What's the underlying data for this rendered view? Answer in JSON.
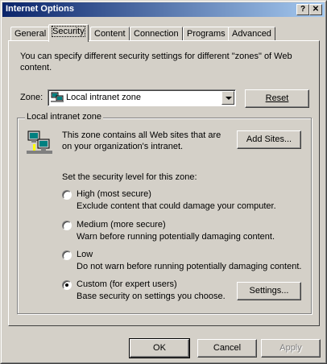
{
  "window": {
    "title": "Internet Options",
    "help_glyph": "?",
    "close_glyph": "✕"
  },
  "tabs": [
    {
      "label": "General"
    },
    {
      "label": "Security",
      "active": true
    },
    {
      "label": "Content"
    },
    {
      "label": "Connection"
    },
    {
      "label": "Programs"
    },
    {
      "label": "Advanced"
    }
  ],
  "security": {
    "intro_line1": "You can specify different security settings for different \"zones\" of Web",
    "intro_line2": "content.",
    "zone_label": "Zone:",
    "zone_selected": "Local intranet zone",
    "reset_label": "Reset",
    "group_title": "Local intranet zone",
    "zone_desc_line1": "This zone contains all Web sites that are",
    "zone_desc_line2": "on your organization's intranet.",
    "add_sites_label": "Add Sites...",
    "level_prompt": "Set the security level for this zone:",
    "levels": [
      {
        "name": "High (most secure)",
        "desc": "Exclude content that could damage your computer.",
        "checked": false
      },
      {
        "name": "Medium (more secure)",
        "desc": "Warn before running potentially damaging content.",
        "checked": false
      },
      {
        "name": "Low",
        "desc": "Do not warn before running potentially damaging content.",
        "checked": false
      },
      {
        "name": "Custom (for expert users)",
        "desc": "Base security on settings you choose.",
        "checked": true
      }
    ],
    "settings_label": "Settings..."
  },
  "footer": {
    "ok_label": "OK",
    "cancel_label": "Cancel",
    "apply_label": "Apply"
  },
  "icons": {
    "title_help": "help-icon",
    "title_close": "close-icon",
    "zone_combo": "intranet-zone-icon",
    "group": "intranet-computers-icon"
  },
  "colors": {
    "title_gradient_start": "#0a246a",
    "title_gradient_end": "#a6caf0",
    "face": "#d4d0c8"
  }
}
